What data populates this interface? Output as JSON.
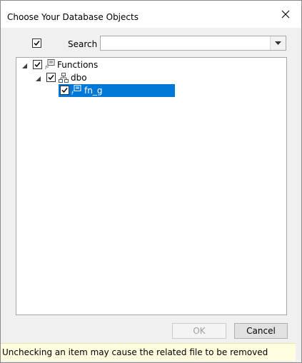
{
  "window": {
    "title": "Choose Your Database Objects"
  },
  "toolbar": {
    "search_label": "Search",
    "search_value": "",
    "select_all_checked": true
  },
  "tree": {
    "nodes": [
      {
        "label": "Functions",
        "checked": true,
        "expanded": true
      },
      {
        "label": "dbo",
        "checked": true,
        "expanded": true
      },
      {
        "label": "fn_g",
        "checked": true,
        "selected": true
      }
    ]
  },
  "buttons": {
    "ok": "OK",
    "cancel": "Cancel"
  },
  "hint": "Unchecking an item may cause the related file to be removed",
  "colors": {
    "selection": "#0078d7",
    "hint_background": "#fffde0"
  }
}
